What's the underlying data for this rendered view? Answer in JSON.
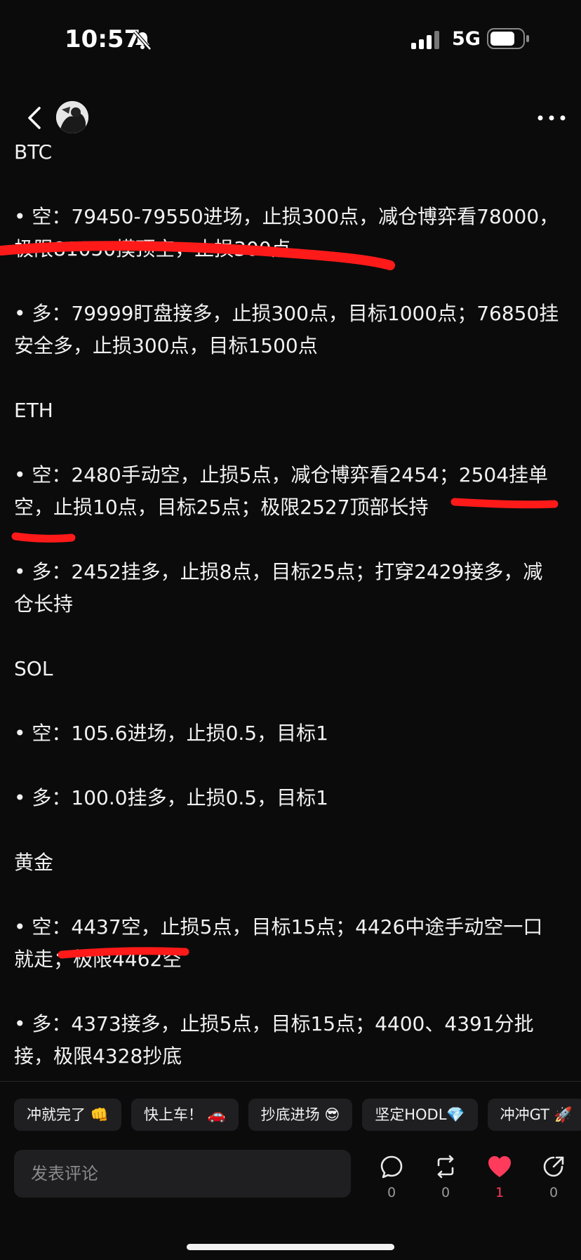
{
  "status_bar": {
    "time": "10:57",
    "network": "5G"
  },
  "nav": {
    "back_icon": "chevron-left-icon",
    "avatar": "user-avatar",
    "more_icon": "more-horizontal-icon"
  },
  "post": {
    "lines": [
      {
        "text": "BTC",
        "heading": true
      },
      {
        "text": "• 空：79450-79550进场，止损300点，减仓博弈看78000，极限81050摸顶空，止损300点"
      },
      {
        "text": "• 多：79999盯盘接多，止损300点，目标1000点；76850挂安全多，止损300点，目标1500点"
      },
      {
        "text": "ETH",
        "heading": true
      },
      {
        "text": "• 空：2480手动空，止损5点，减仓博弈看2454；2504挂单空，止损10点，目标25点；极限2527顶部长持"
      },
      {
        "text": "• 多：2452挂多，止损8点，目标25点；打穿2429接多，减仓长持"
      },
      {
        "text": "SOL",
        "heading": true
      },
      {
        "text": "• 空：105.6进场，止损0.5，目标1"
      },
      {
        "text": "• 多：100.0挂多，止损0.5，目标1"
      },
      {
        "text": "黄金",
        "heading": true
      },
      {
        "text": "• 空：4437空，止损5点，目标15点；4426中途手动空一口就走；极限4462空"
      },
      {
        "text": "• 多：4373接多，止损5点，目标15点；4400、4391分批接，极限4328抄底"
      }
    ]
  },
  "quick_replies": [
    "冲就完了 👊",
    "快上车！ 🚗",
    "抄底进场 😎",
    "坚定HODL💎",
    "冲冲GT 🚀"
  ],
  "comment": {
    "placeholder": "发表评论"
  },
  "actions": {
    "comment_count": "0",
    "repost_count": "0",
    "like_count": "1",
    "share_count": "0"
  },
  "colors": {
    "background": "#0b0b0b",
    "annotation_red": "#ff1a1a",
    "like_red": "#ff3b5c"
  }
}
